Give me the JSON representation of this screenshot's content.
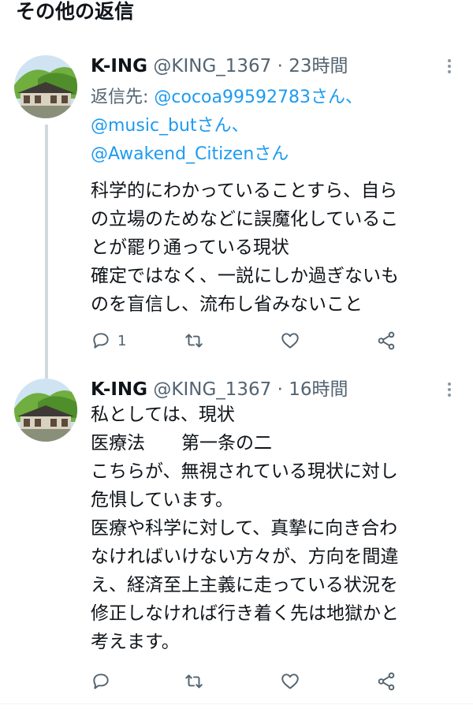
{
  "section": {
    "title": "その他の返信"
  },
  "tweets": [
    {
      "name": "K-ING",
      "handle": "@KING_1367",
      "dot": "·",
      "time": "23時間",
      "replying_prefix": "返信先: ",
      "mentions": [
        "@cocoa99592783さん、",
        "@music_butさん、",
        "@Awakend_Citizenさん"
      ],
      "lines": [
        "科学的にわかっていることすら、自ら",
        "の立場のためなどに誤魔化しているこ",
        "とが罷り通っている現状",
        "確定ではなく、一説にしか過ぎないも",
        "のを盲信し、流布し省みないこと"
      ],
      "reply_count": "1",
      "retweet_count": "",
      "like_count": ""
    },
    {
      "name": "K-ING",
      "handle": "@KING_1367",
      "dot": "·",
      "time": "16時間",
      "lines": [
        "私としては、現状",
        "医療法　　第一条の二",
        "こちらが、無視されている現状に対し",
        "危惧しています。",
        "医療や科学に対して、真摯に向き合わ",
        "なければいけない方々が、方向を間違",
        "え、経済至上主義に走っている状況を",
        "修正しなければ行き着く先は地獄かと",
        "考えます。"
      ],
      "reply_count": "",
      "retweet_count": "",
      "like_count": ""
    }
  ],
  "colors": {
    "accent": "#1d9bf0",
    "secondary_text": "#536471",
    "thread_line": "#cfd9de"
  },
  "icons": [
    "reply-icon",
    "retweet-icon",
    "like-icon",
    "share-icon",
    "more-icon"
  ]
}
